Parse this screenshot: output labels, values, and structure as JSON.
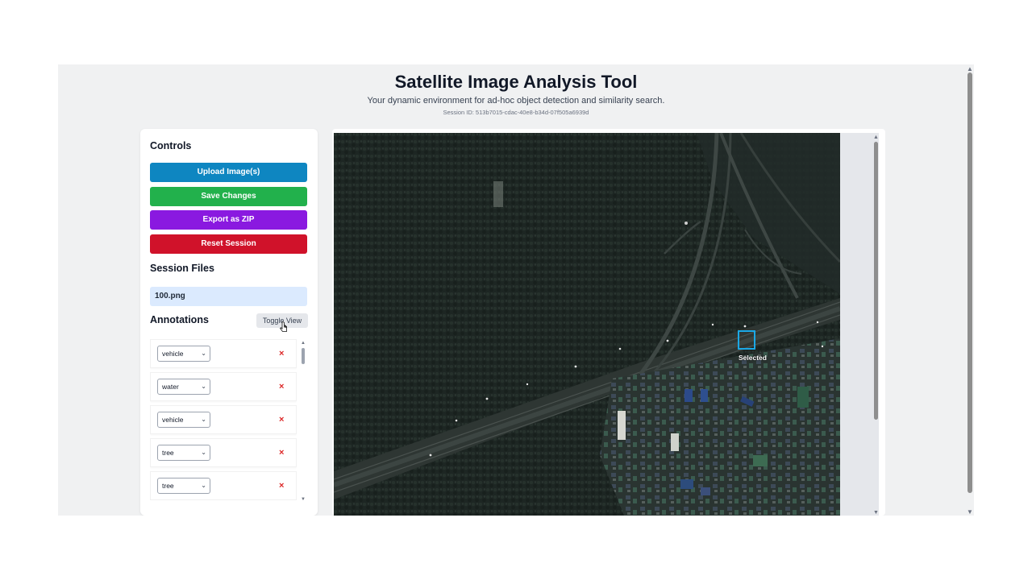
{
  "header": {
    "title": "Satellite Image Analysis Tool",
    "subtitle": "Your dynamic environment for ad-hoc object detection and similarity search.",
    "session_id": "Session ID: 513b7015-cdac-40e8-b34d-07f505a6939d"
  },
  "controls": {
    "heading": "Controls",
    "upload_label": "Upload Image(s)",
    "save_label": "Save Changes",
    "export_label": "Export as ZIP",
    "reset_label": "Reset Session"
  },
  "session_files": {
    "heading": "Session Files",
    "files": [
      "100.png"
    ]
  },
  "annotations": {
    "heading": "Annotations",
    "toggle_label": "Toggle View",
    "delete_glyph": "×",
    "items": [
      {
        "label": "vehicle"
      },
      {
        "label": "water"
      },
      {
        "label": "vehicle"
      },
      {
        "label": "tree"
      },
      {
        "label": "tree"
      }
    ]
  },
  "image_view": {
    "selected_label": "Selected",
    "selection_color": "#1ba8e6"
  },
  "colors": {
    "upload": "#0e86c1",
    "save": "#22b14c",
    "export": "#8a19e0",
    "reset": "#d0122a",
    "file_selected_bg": "#dbeafe"
  }
}
